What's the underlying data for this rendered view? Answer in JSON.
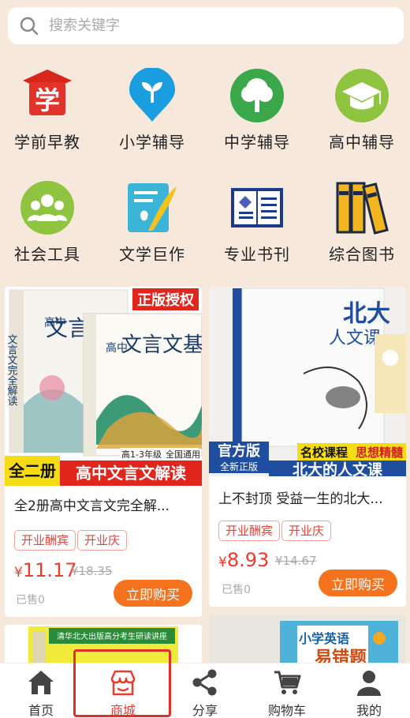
{
  "search": {
    "placeholder": "搜索关键字"
  },
  "categories": [
    {
      "label": "学前早教",
      "icon": "school-hat-icon",
      "glyph": "学"
    },
    {
      "label": "小学辅导",
      "icon": "sprout-pin-icon"
    },
    {
      "label": "中学辅导",
      "icon": "tree-icon"
    },
    {
      "label": "高中辅导",
      "icon": "graduation-cap-icon"
    },
    {
      "label": "社会工具",
      "icon": "people-icon"
    },
    {
      "label": "文学巨作",
      "icon": "notebook-quill-icon"
    },
    {
      "label": "专业书刊",
      "icon": "open-book-icon"
    },
    {
      "label": "综合图书",
      "icon": "books-icon"
    }
  ],
  "products": [
    {
      "title": "全2册高中文言文完全解...",
      "tags": [
        "开业酬宾",
        "开业庆"
      ],
      "price_symbol": "¥",
      "price": "11.17",
      "old_price": "¥18.35",
      "sold": "已售0",
      "buy_label": "立即购买",
      "image_text": {
        "badge": "正版授权",
        "book1": "文言文完全解读",
        "book1_prefix": "高中",
        "book2_prefix": "高中",
        "book2": "文言文基础知识",
        "grade": "高1-3年级",
        "scope": "全国通用",
        "set": "全二册",
        "banner": "高中文言文解读"
      }
    },
    {
      "title": "上不封顶 受益一生的北大...",
      "tags": [
        "开业酬宾",
        "开业庆"
      ],
      "price_symbol": "¥",
      "price": "8.93",
      "old_price": "¥14.67",
      "sold": "已售0",
      "buy_label": "立即购买",
      "image_text": {
        "book": "北大人文课",
        "official": "官方版",
        "new": "全新正版",
        "school": "名校课程",
        "slogan": "思想精髓",
        "banner": "北大的人文课"
      }
    }
  ],
  "partial_products": [
    {
      "image_text": {
        "header": "清华北大出版高分考生研读讲座"
      }
    },
    {
      "image_text": {
        "title": "小学英语",
        "subtitle": "易错题"
      }
    }
  ],
  "nav": [
    {
      "label": "首页",
      "icon": "home-icon"
    },
    {
      "label": "商城",
      "icon": "shop-icon",
      "active": true
    },
    {
      "label": "分享",
      "icon": "share-icon"
    },
    {
      "label": "购物车",
      "icon": "cart-icon"
    },
    {
      "label": "我的",
      "icon": "user-icon"
    }
  ],
  "colors": {
    "background": "#f7e8dc",
    "price": "#ef3a2a",
    "buy_button": "#f5731e",
    "nav_active": "#e83c2f"
  }
}
